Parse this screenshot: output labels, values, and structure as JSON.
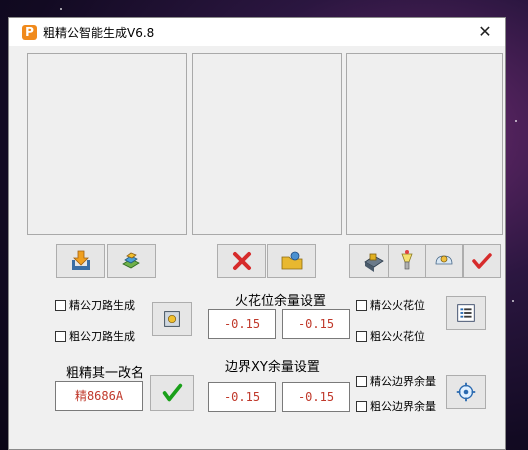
{
  "window": {
    "title": "粗精公智能生成V6.8",
    "logo_letter": "P",
    "close_glyph": "✕"
  },
  "panels": [
    "preview-left",
    "preview-middle",
    "preview-right"
  ],
  "toolbar_icons": [
    "import-icon",
    "parts-icon",
    "delete-icon",
    "folder-icon",
    "machine-icon",
    "lamp-icon",
    "gear-icon",
    "check-icon"
  ],
  "options": {
    "fine_toolpath_label": "精公刀路生成",
    "rough_toolpath_label": "粗公刀路生成",
    "fine_spark_label": "精公火花位",
    "rough_spark_label": "粗公火花位",
    "fine_edge_label": "精公边界余量",
    "rough_edge_label": "粗公边界余量"
  },
  "spark": {
    "heading": "火花位余量设置",
    "fine_value": "-0.15",
    "rough_value": "-0.15"
  },
  "edge": {
    "heading": "边界XY余量设置",
    "fine_value": "-0.15",
    "rough_value": "-0.15"
  },
  "rename": {
    "heading": "粗精其一改名",
    "value": "精8686A"
  },
  "colors": {
    "value_text": "#c0392b",
    "confirm_green": "#1aa01a",
    "delete_red": "#d62b2b"
  }
}
